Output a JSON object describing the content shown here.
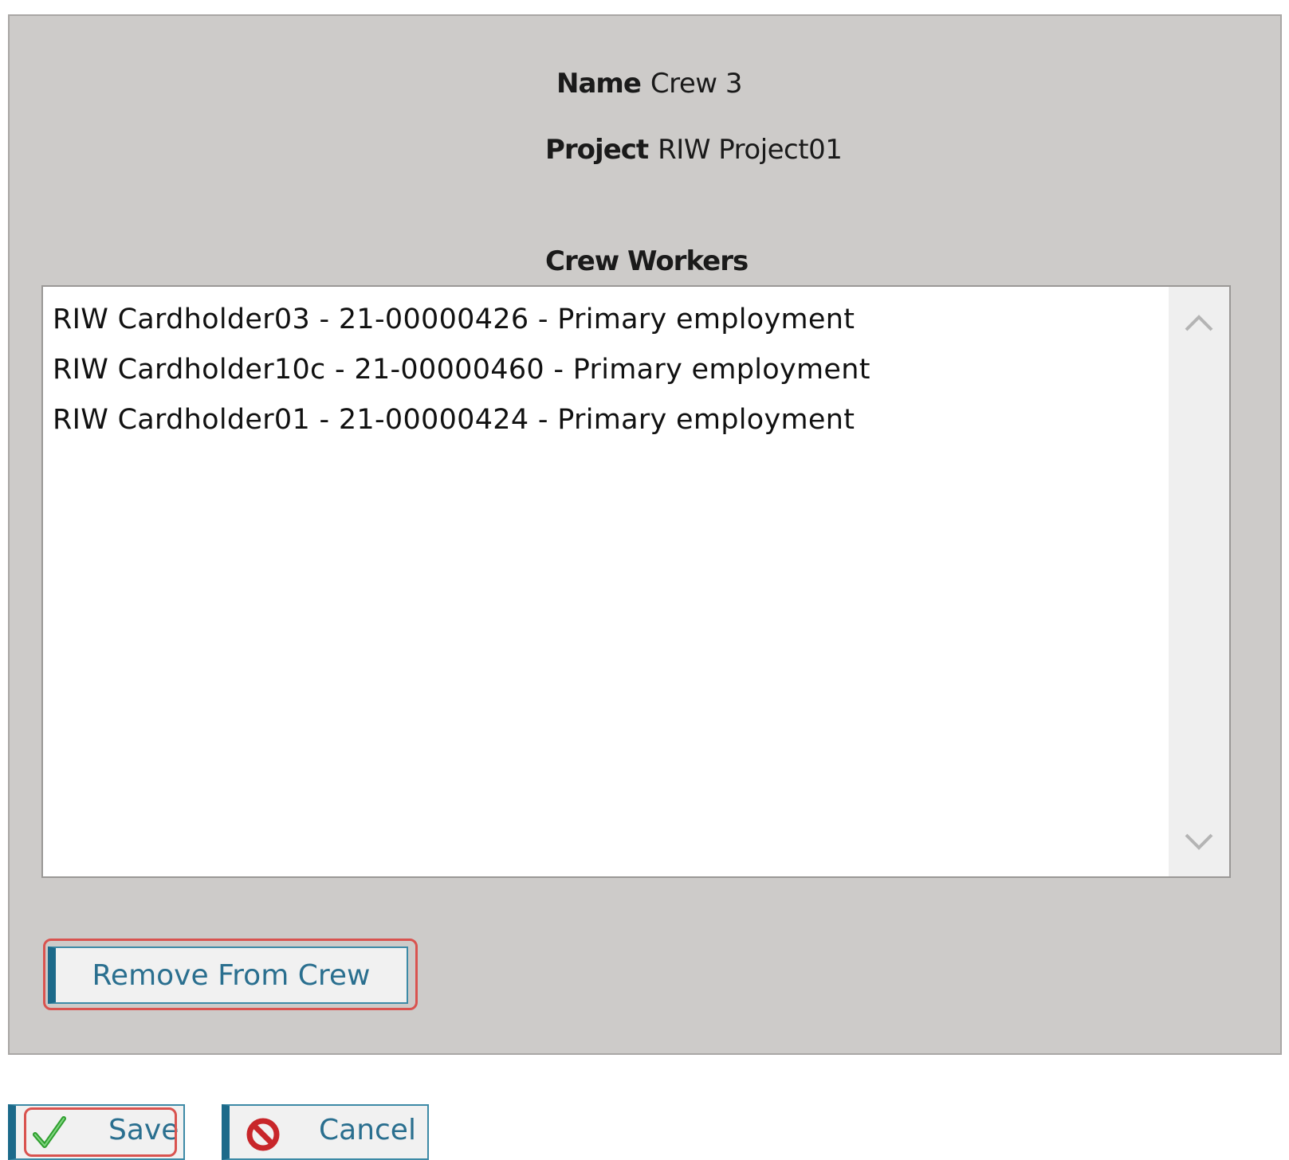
{
  "form": {
    "name_label": "Name",
    "name_value": "Crew 3",
    "project_label": "Project",
    "project_value": "RIW Project01"
  },
  "crew_workers": {
    "title": "Crew Workers",
    "items": [
      "RIW Cardholder03 - 21-00000426 - Primary employment",
      "RIW Cardholder10c - 21-00000460 - Primary employment",
      "RIW Cardholder01 - 21-00000424 - Primary employment"
    ]
  },
  "buttons": {
    "remove_label": "Remove From Crew",
    "save_label": "Save",
    "cancel_label": "Cancel"
  },
  "icons": {
    "save": "checkmark-icon",
    "cancel": "prohibited-icon",
    "scroll_up": "chevron-up-icon",
    "scroll_down": "chevron-down-icon"
  },
  "colors": {
    "panel_background": "#cdcbc9",
    "button_accent": "#1c6a8a",
    "button_text": "#2a6f8f",
    "highlight": "#d9534f"
  }
}
